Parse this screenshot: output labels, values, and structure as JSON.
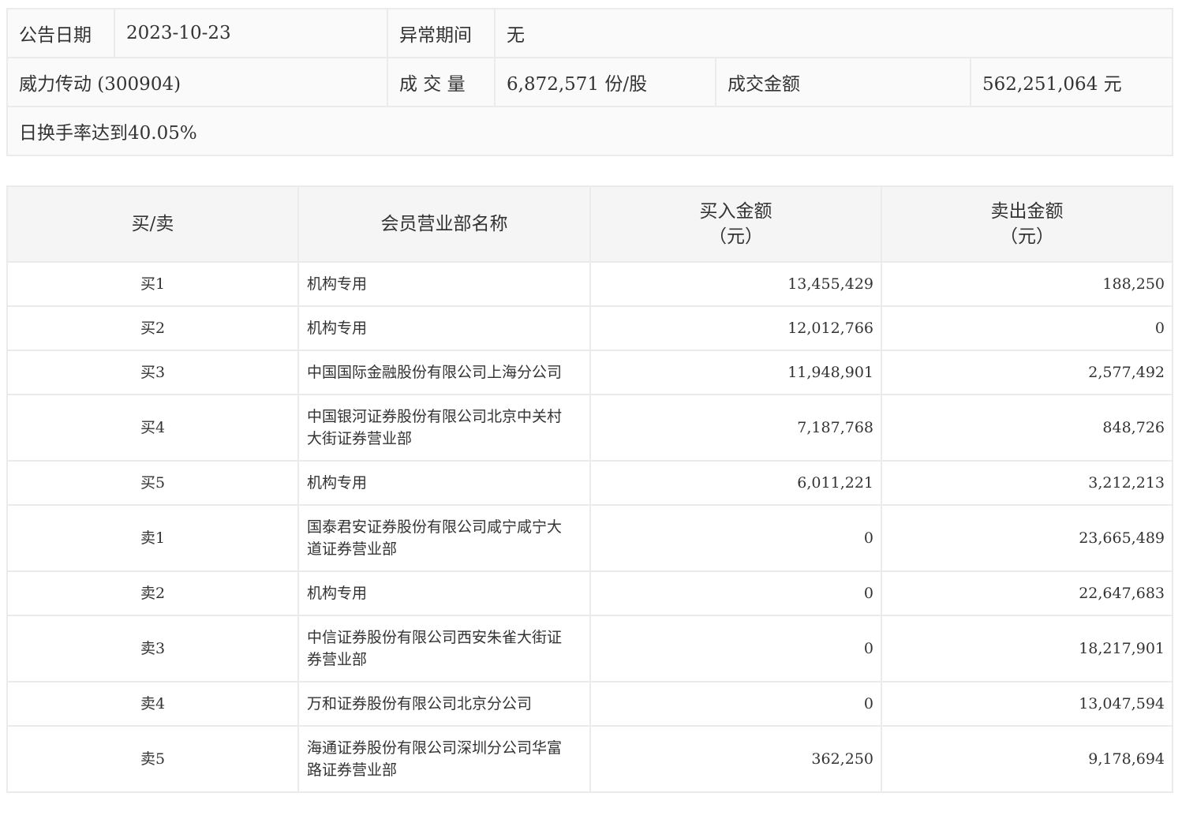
{
  "summary": {
    "date_label": "公告日期",
    "date_value": "2023-10-23",
    "period_label": "异常期间",
    "period_value": "无",
    "stock": "威力传动 (300904)",
    "volume_label": "成 交 量",
    "volume_value": "6,872,571 份/股",
    "amount_label": "成交金额",
    "amount_value": "562,251,064 元",
    "reason": "日换手率达到40.05%"
  },
  "table": {
    "headers": {
      "side": "买/卖",
      "name": "会员营业部名称",
      "buy_line1": "买入金额",
      "buy_line2": "（元）",
      "sell_line1": "卖出金额",
      "sell_line2": "（元）"
    },
    "rows": [
      {
        "side": "买1",
        "name": "机构专用",
        "buy": "13,455,429",
        "sell": "188,250"
      },
      {
        "side": "买2",
        "name": "机构专用",
        "buy": "12,012,766",
        "sell": "0"
      },
      {
        "side": "买3",
        "name": "中国国际金融股份有限公司上海分公司",
        "buy": "11,948,901",
        "sell": "2,577,492"
      },
      {
        "side": "买4",
        "name": "中国银河证券股份有限公司北京中关村大街证券营业部",
        "buy": "7,187,768",
        "sell": "848,726"
      },
      {
        "side": "买5",
        "name": "机构专用",
        "buy": "6,011,221",
        "sell": "3,212,213"
      },
      {
        "side": "卖1",
        "name": "国泰君安证券股份有限公司咸宁咸宁大道证券营业部",
        "buy": "0",
        "sell": "23,665,489"
      },
      {
        "side": "卖2",
        "name": "机构专用",
        "buy": "0",
        "sell": "22,647,683"
      },
      {
        "side": "卖3",
        "name": "中信证券股份有限公司西安朱雀大街证券营业部",
        "buy": "0",
        "sell": "18,217,901"
      },
      {
        "side": "卖4",
        "name": "万和证券股份有限公司北京分公司",
        "buy": "0",
        "sell": "13,047,594"
      },
      {
        "side": "卖5",
        "name": "海通证券股份有限公司深圳分公司华富路证券营业部",
        "buy": "362,250",
        "sell": "9,178,694"
      }
    ]
  }
}
